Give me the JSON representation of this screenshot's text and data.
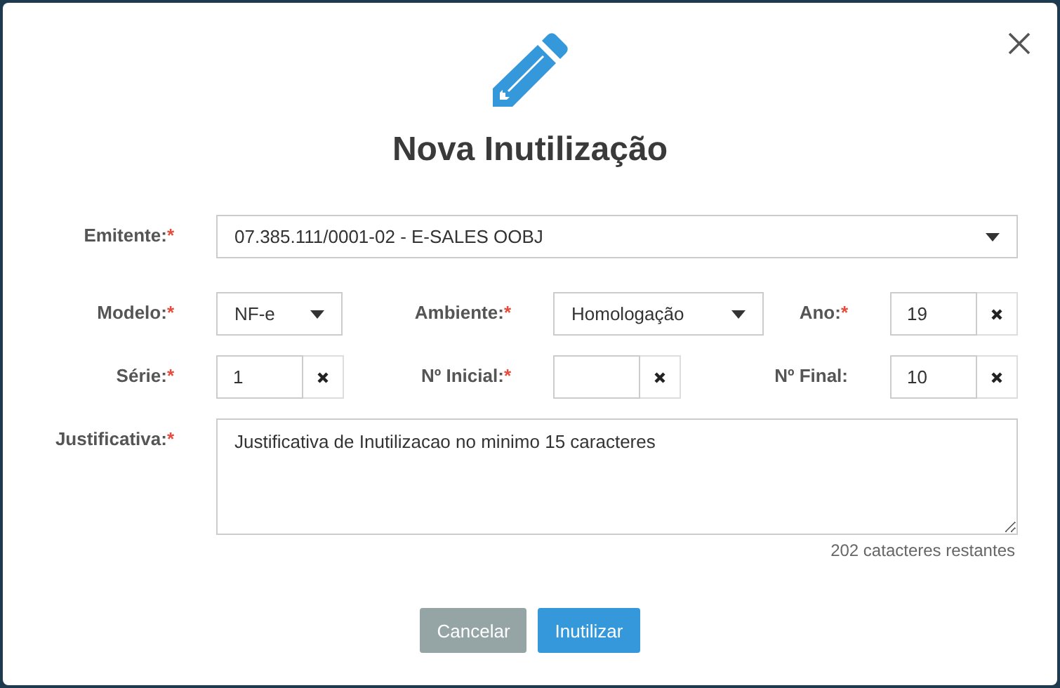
{
  "dialog": {
    "title": "Nova Inutilização"
  },
  "rows": [
    [
      {
        "label": "Emitente:",
        "mark": "*",
        "kind": "select",
        "value": "07.385.111/0001-02 - E-SALES OOBJ"
      }
    ],
    [
      {
        "label": "Modelo:",
        "mark": "*",
        "kind": "select",
        "value": "NF-e"
      },
      {
        "label": "Ambiente:",
        "mark": "*",
        "kind": "select",
        "value": "Homologação"
      },
      {
        "label": "Ano:",
        "mark": "*",
        "kind": "input",
        "value": "19"
      }
    ],
    [
      {
        "label": "Série:",
        "mark": "*",
        "kind": "input",
        "value": "1"
      },
      {
        "label": "Nº Inicial:",
        "mark": "*",
        "kind": "input"
      },
      {
        "label": "Nº Final:",
        "kind": "input",
        "value": "10"
      }
    ]
  ],
  "justificativa": {
    "label": "Justificativa:",
    "mark": "*",
    "value": "Justificativa de Inutilizacao no minimo 15 caracteres",
    "counter": "202 catacteres restantes"
  },
  "buttons": [
    {
      "label": "Cancelar",
      "kind": "secondary"
    },
    {
      "label": "Inutilizar",
      "kind": "primary"
    }
  ]
}
